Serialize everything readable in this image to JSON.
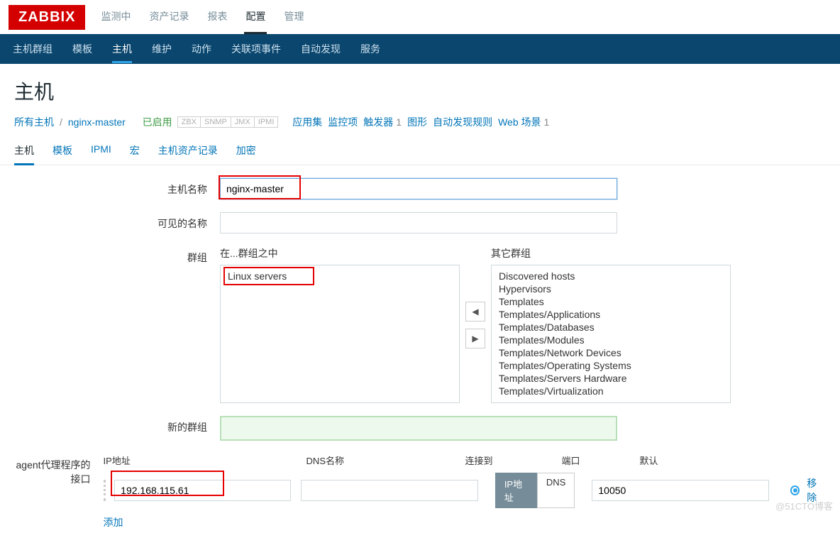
{
  "logo": "ZABBIX",
  "topnav": {
    "items": [
      "监测中",
      "资产记录",
      "报表",
      "配置",
      "管理"
    ],
    "active": 3
  },
  "subnav": {
    "items": [
      "主机群组",
      "模板",
      "主机",
      "维护",
      "动作",
      "关联项事件",
      "自动发现",
      "服务"
    ],
    "active": 2
  },
  "page_title": "主机",
  "crumbs": {
    "all_hosts": "所有主机",
    "host": "nginx-master",
    "status": "已启用",
    "badges": [
      "ZBX",
      "SNMP",
      "JMX",
      "IPMI"
    ],
    "links": {
      "apps": "应用集",
      "items": "监控项",
      "triggers": "触发器",
      "triggers_n": "1",
      "graphs": "图形",
      "discovery": "自动发现规则",
      "web": "Web 场景",
      "web_n": "1"
    }
  },
  "tabs": {
    "items": [
      "主机",
      "模板",
      "IPMI",
      "宏",
      "主机资产记录",
      "加密"
    ],
    "active": 0
  },
  "form": {
    "host_label": "主机名称",
    "host_value": "nginx-master",
    "visible_label": "可见的名称",
    "visible_value": "",
    "groups_label": "群组",
    "in_groups_label": "在...群组之中",
    "in_groups": [
      "Linux servers"
    ],
    "other_groups_label": "其它群组",
    "other_groups": [
      "Discovered hosts",
      "Hypervisors",
      "Templates",
      "Templates/Applications",
      "Templates/Databases",
      "Templates/Modules",
      "Templates/Network Devices",
      "Templates/Operating Systems",
      "Templates/Servers Hardware",
      "Templates/Virtualization"
    ],
    "new_group_label": "新的群组",
    "new_group_value": "",
    "iface_label": "agent代理程序的接口",
    "iface_cols": {
      "ip": "IP地址",
      "dns": "DNS名称",
      "connect": "连接到",
      "port": "端口",
      "default": "默认"
    },
    "iface": {
      "ip": "192.168.115.61",
      "dns": "",
      "connect_ip": "IP地址",
      "connect_dns": "DNS",
      "port": "10050",
      "remove": "移除"
    },
    "add": "添加"
  },
  "watermark": "@51CTO博客"
}
